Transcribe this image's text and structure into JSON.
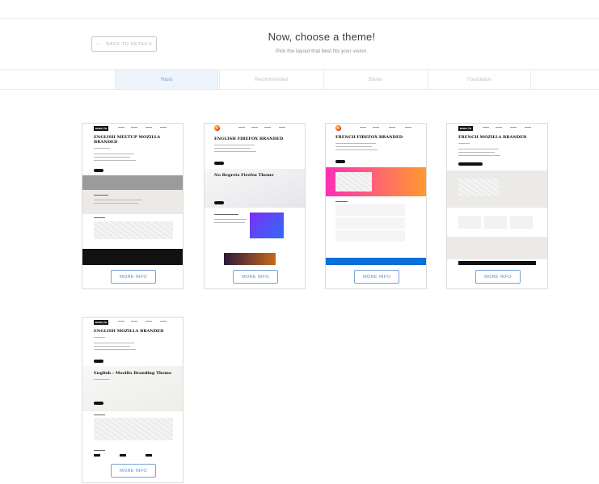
{
  "header": {
    "back_label": "BACK TO DETAILS",
    "back_icon": "arrow-left-icon",
    "title": "Now, choose a theme!",
    "subtitle": "Pick the layout that best fits your vision."
  },
  "tabs": [
    {
      "label": "Yours",
      "active": true
    },
    {
      "label": "Recommended",
      "active": false
    },
    {
      "label": "Starter",
      "active": false
    },
    {
      "label": "Foundation",
      "active": false
    }
  ],
  "themes": [
    {
      "logo": "moz://a",
      "title": "ENGLISH MEETUP MOZILLA BRANDED",
      "section_title": "",
      "more_label": "MORE INFO"
    },
    {
      "logo": "",
      "title": "ENGLISH FIREFOX BRANDED",
      "section_title": "No Regrets Firefox Theme",
      "more_label": "MORE INFO"
    },
    {
      "logo": "",
      "title": "FRENCH FIREFOX BRANDED",
      "section_title": "",
      "more_label": "MORE INFO"
    },
    {
      "logo": "moz://a",
      "title": "FRENCH MOZILLA BRANDED",
      "section_title": "",
      "more_label": "MORE INFO"
    },
    {
      "logo": "moz://a",
      "title": "ENGLISH MOZILLA BRANDED",
      "section_title": "English - Mozilla Branding Theme",
      "more_label": "MORE INFO"
    }
  ],
  "colors": {
    "accent": "#5b8fd0",
    "active_tab_bg": "#eef4fb",
    "gradient_start": "#ff2fb4",
    "gradient_end": "#ff9a2e",
    "bar_blue": "#0a6fd6"
  }
}
